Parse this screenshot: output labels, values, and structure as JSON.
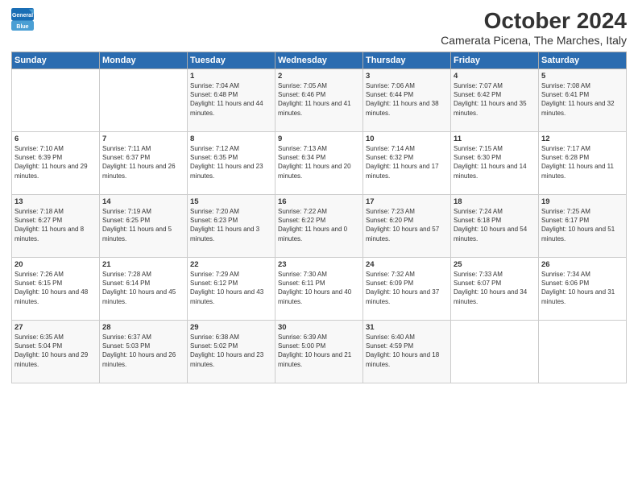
{
  "header": {
    "logo_line1": "General",
    "logo_line2": "Blue",
    "title": "October 2024",
    "subtitle": "Camerata Picena, The Marches, Italy"
  },
  "weekdays": [
    "Sunday",
    "Monday",
    "Tuesday",
    "Wednesday",
    "Thursday",
    "Friday",
    "Saturday"
  ],
  "weeks": [
    [
      {
        "day": "",
        "info": ""
      },
      {
        "day": "",
        "info": ""
      },
      {
        "day": "1",
        "info": "Sunrise: 7:04 AM\nSunset: 6:48 PM\nDaylight: 11 hours and 44 minutes."
      },
      {
        "day": "2",
        "info": "Sunrise: 7:05 AM\nSunset: 6:46 PM\nDaylight: 11 hours and 41 minutes."
      },
      {
        "day": "3",
        "info": "Sunrise: 7:06 AM\nSunset: 6:44 PM\nDaylight: 11 hours and 38 minutes."
      },
      {
        "day": "4",
        "info": "Sunrise: 7:07 AM\nSunset: 6:42 PM\nDaylight: 11 hours and 35 minutes."
      },
      {
        "day": "5",
        "info": "Sunrise: 7:08 AM\nSunset: 6:41 PM\nDaylight: 11 hours and 32 minutes."
      }
    ],
    [
      {
        "day": "6",
        "info": "Sunrise: 7:10 AM\nSunset: 6:39 PM\nDaylight: 11 hours and 29 minutes."
      },
      {
        "day": "7",
        "info": "Sunrise: 7:11 AM\nSunset: 6:37 PM\nDaylight: 11 hours and 26 minutes."
      },
      {
        "day": "8",
        "info": "Sunrise: 7:12 AM\nSunset: 6:35 PM\nDaylight: 11 hours and 23 minutes."
      },
      {
        "day": "9",
        "info": "Sunrise: 7:13 AM\nSunset: 6:34 PM\nDaylight: 11 hours and 20 minutes."
      },
      {
        "day": "10",
        "info": "Sunrise: 7:14 AM\nSunset: 6:32 PM\nDaylight: 11 hours and 17 minutes."
      },
      {
        "day": "11",
        "info": "Sunrise: 7:15 AM\nSunset: 6:30 PM\nDaylight: 11 hours and 14 minutes."
      },
      {
        "day": "12",
        "info": "Sunrise: 7:17 AM\nSunset: 6:28 PM\nDaylight: 11 hours and 11 minutes."
      }
    ],
    [
      {
        "day": "13",
        "info": "Sunrise: 7:18 AM\nSunset: 6:27 PM\nDaylight: 11 hours and 8 minutes."
      },
      {
        "day": "14",
        "info": "Sunrise: 7:19 AM\nSunset: 6:25 PM\nDaylight: 11 hours and 5 minutes."
      },
      {
        "day": "15",
        "info": "Sunrise: 7:20 AM\nSunset: 6:23 PM\nDaylight: 11 hours and 3 minutes."
      },
      {
        "day": "16",
        "info": "Sunrise: 7:22 AM\nSunset: 6:22 PM\nDaylight: 11 hours and 0 minutes."
      },
      {
        "day": "17",
        "info": "Sunrise: 7:23 AM\nSunset: 6:20 PM\nDaylight: 10 hours and 57 minutes."
      },
      {
        "day": "18",
        "info": "Sunrise: 7:24 AM\nSunset: 6:18 PM\nDaylight: 10 hours and 54 minutes."
      },
      {
        "day": "19",
        "info": "Sunrise: 7:25 AM\nSunset: 6:17 PM\nDaylight: 10 hours and 51 minutes."
      }
    ],
    [
      {
        "day": "20",
        "info": "Sunrise: 7:26 AM\nSunset: 6:15 PM\nDaylight: 10 hours and 48 minutes."
      },
      {
        "day": "21",
        "info": "Sunrise: 7:28 AM\nSunset: 6:14 PM\nDaylight: 10 hours and 45 minutes."
      },
      {
        "day": "22",
        "info": "Sunrise: 7:29 AM\nSunset: 6:12 PM\nDaylight: 10 hours and 43 minutes."
      },
      {
        "day": "23",
        "info": "Sunrise: 7:30 AM\nSunset: 6:11 PM\nDaylight: 10 hours and 40 minutes."
      },
      {
        "day": "24",
        "info": "Sunrise: 7:32 AM\nSunset: 6:09 PM\nDaylight: 10 hours and 37 minutes."
      },
      {
        "day": "25",
        "info": "Sunrise: 7:33 AM\nSunset: 6:07 PM\nDaylight: 10 hours and 34 minutes."
      },
      {
        "day": "26",
        "info": "Sunrise: 7:34 AM\nSunset: 6:06 PM\nDaylight: 10 hours and 31 minutes."
      }
    ],
    [
      {
        "day": "27",
        "info": "Sunrise: 6:35 AM\nSunset: 5:04 PM\nDaylight: 10 hours and 29 minutes."
      },
      {
        "day": "28",
        "info": "Sunrise: 6:37 AM\nSunset: 5:03 PM\nDaylight: 10 hours and 26 minutes."
      },
      {
        "day": "29",
        "info": "Sunrise: 6:38 AM\nSunset: 5:02 PM\nDaylight: 10 hours and 23 minutes."
      },
      {
        "day": "30",
        "info": "Sunrise: 6:39 AM\nSunset: 5:00 PM\nDaylight: 10 hours and 21 minutes."
      },
      {
        "day": "31",
        "info": "Sunrise: 6:40 AM\nSunset: 4:59 PM\nDaylight: 10 hours and 18 minutes."
      },
      {
        "day": "",
        "info": ""
      },
      {
        "day": "",
        "info": ""
      }
    ]
  ]
}
